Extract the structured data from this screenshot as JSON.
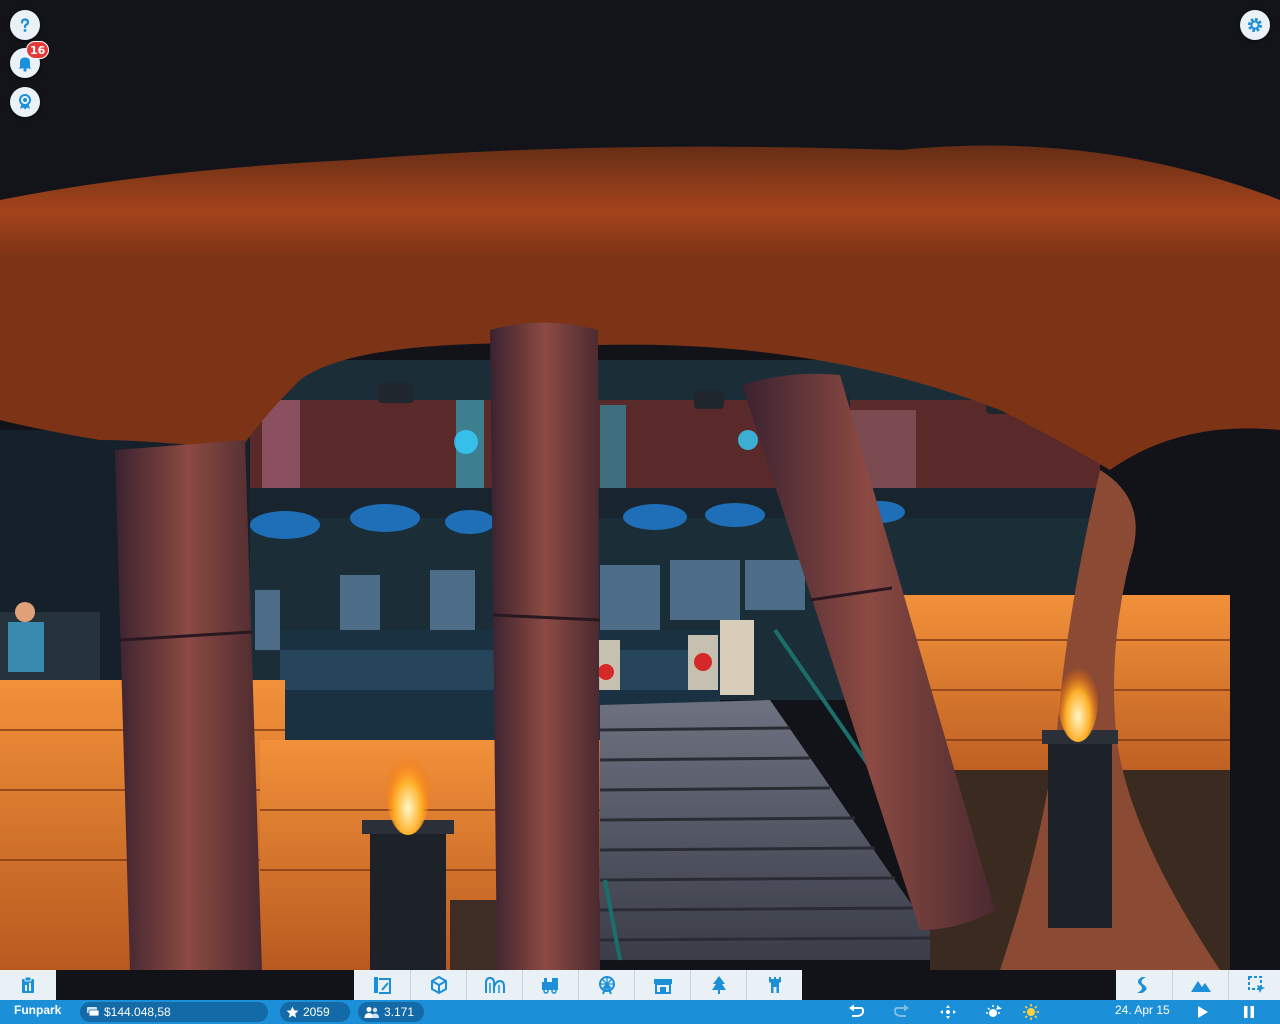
{
  "hud": {
    "help_icon": "question-mark-icon",
    "notifications_icon": "bell-icon",
    "notifications_count": "16",
    "awards_icon": "award-icon",
    "settings_icon": "gear-icon"
  },
  "toolbar": {
    "left": [
      {
        "name": "park-management",
        "icon": "clipboard-icon"
      }
    ],
    "center": [
      {
        "name": "blueprints",
        "icon": "blueprint-icon"
      },
      {
        "name": "construction",
        "icon": "cube-icon"
      },
      {
        "name": "coasters",
        "icon": "coaster-icon"
      },
      {
        "name": "transport-rides",
        "icon": "train-icon"
      },
      {
        "name": "flat-rides",
        "icon": "ferris-wheel-icon"
      },
      {
        "name": "shops",
        "icon": "shop-icon"
      },
      {
        "name": "scenery",
        "icon": "tree-icon"
      },
      {
        "name": "themed-buildings",
        "icon": "tower-icon"
      }
    ],
    "right": [
      {
        "name": "paths",
        "icon": "path-icon"
      },
      {
        "name": "terrain",
        "icon": "mountain-icon"
      },
      {
        "name": "selection",
        "icon": "selection-icon"
      }
    ]
  },
  "status_bar": {
    "park_name": "Funpark",
    "money": "$144.048,58",
    "rating": "2059",
    "guests": "3.171",
    "date": "24. Apr 15",
    "weather_icon": "sun-icon",
    "colors": {
      "bar": "#1b8fd8",
      "pill": "#136aa6"
    }
  }
}
